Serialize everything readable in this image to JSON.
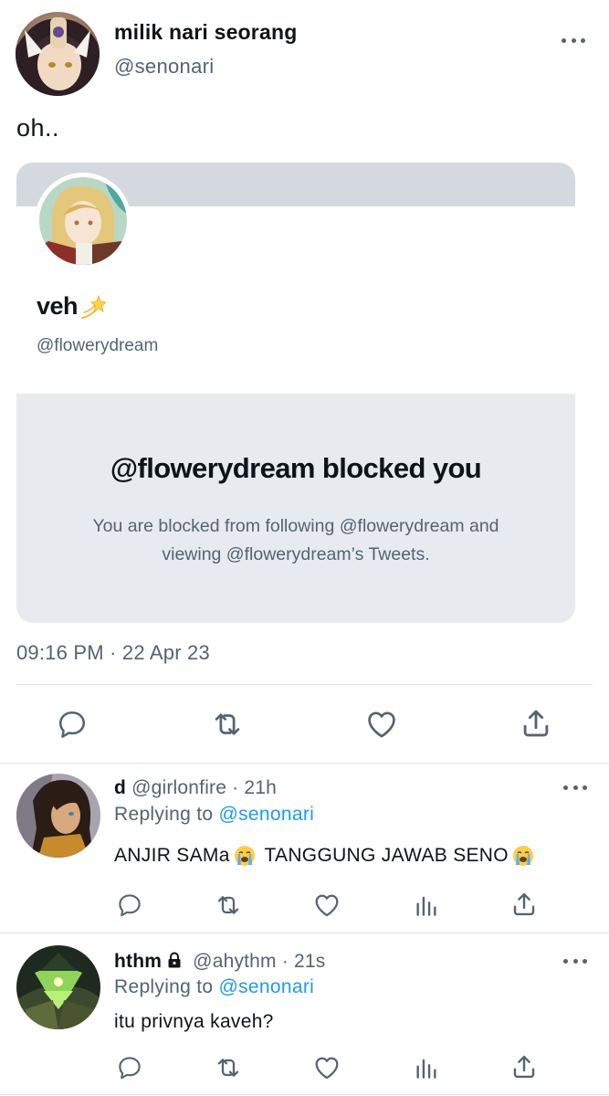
{
  "main_tweet": {
    "display_name": "milik nari seorang",
    "handle": "@senonari",
    "text": "oh..",
    "timestamp": "09:16 PM · 22 Apr 23",
    "more_icon": "more-dots-icon"
  },
  "quoted_card": {
    "display_name": "veh",
    "name_emoji": "dizzy-star-icon",
    "handle": "@flowerydream",
    "blocked_title": "@flowerydream blocked you",
    "blocked_desc_line1": "You are blocked from following @flowerydream and",
    "blocked_desc_line2": "viewing @flowerydream’s Tweets."
  },
  "main_actions": [
    "reply-icon",
    "retweet-icon",
    "like-icon",
    "share-icon"
  ],
  "replies": [
    {
      "display_name": "d",
      "handle": "@girlonfire",
      "separator": " · ",
      "time": "21h",
      "replying_prefix": "Replying to",
      "replying_to": "@senonari",
      "text_part1": "ANJIR SAMa",
      "text_part2": "TANGGUNG JAWAB SENO",
      "emoji": "loudly-crying-face-icon",
      "actions": [
        "reply-icon",
        "retweet-icon",
        "like-icon",
        "analytics-icon",
        "share-icon"
      ]
    },
    {
      "display_name": "hthm",
      "protected_icon": "lock-icon",
      "handle": "@ahythm",
      "separator": " · ",
      "time": "21s",
      "replying_prefix": "Replying to",
      "replying_to": "@senonari",
      "text": "itu privnya kaveh?",
      "actions": [
        "reply-icon",
        "retweet-icon",
        "like-icon",
        "analytics-icon",
        "share-icon"
      ]
    }
  ],
  "colors": {
    "text_primary": "#0f1419",
    "text_secondary": "#536471",
    "link": "#1d9bf0",
    "card_banner": "#d4d9df",
    "blocked_box": "#e7ebef",
    "divider": "#dde1e4"
  }
}
